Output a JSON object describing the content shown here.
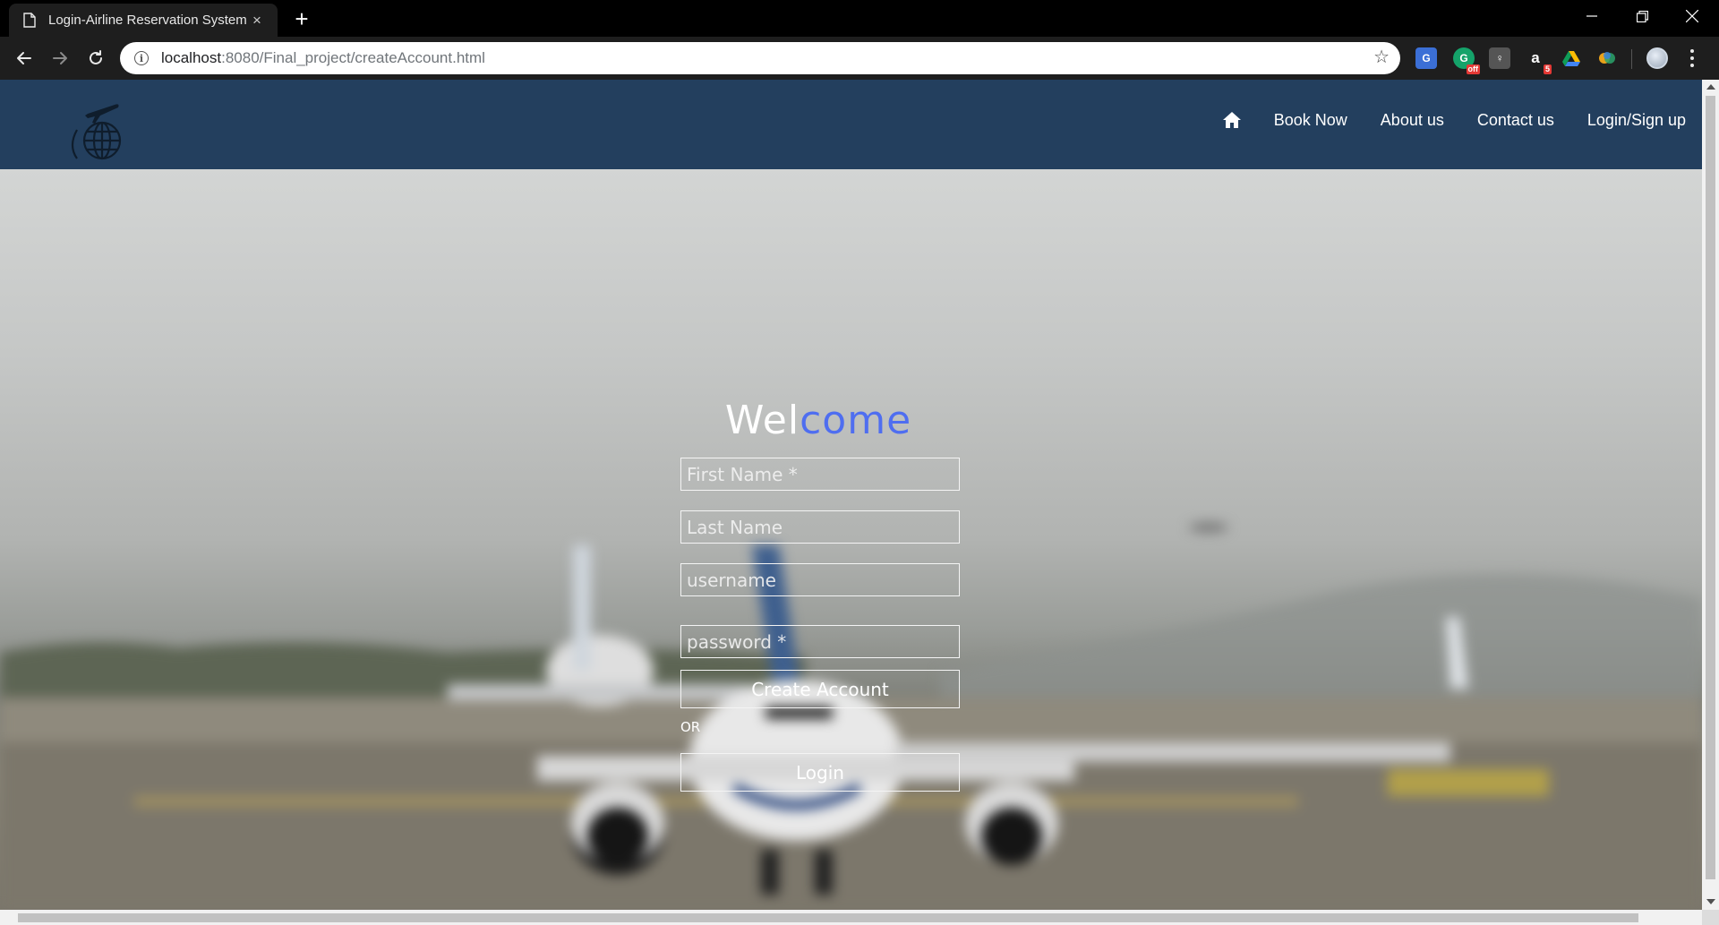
{
  "browser": {
    "tab_title": "Login-Airline Reservation System",
    "new_tab_symbol": "+",
    "tab_close_symbol": "×",
    "url_host": "localhost",
    "url_rest": ":8080/Final_project/createAccount.html",
    "info_symbol": "i",
    "bookmark_symbol": "☆",
    "extensions": [
      {
        "name": "translate-extension-icon",
        "label": "G"
      },
      {
        "name": "grammarly-extension-icon",
        "label": "G",
        "badge": "off"
      },
      {
        "name": "keep-extension-icon",
        "label": "♀"
      },
      {
        "name": "amazon-extension-icon",
        "label": "a",
        "badge": "5"
      },
      {
        "name": "drive-extension-icon",
        "label": ""
      },
      {
        "name": "colorful-extension-icon",
        "label": ""
      }
    ]
  },
  "nav": {
    "items": [
      {
        "label": "Book Now"
      },
      {
        "label": "About us"
      },
      {
        "label": "Contact us"
      },
      {
        "label": "Login/Sign up"
      }
    ]
  },
  "form": {
    "welcome_part1": "Wel",
    "welcome_part2": "come",
    "first_name_placeholder": "First Name *",
    "last_name_placeholder": "Last Name",
    "username_placeholder": "username",
    "password_placeholder": "password *",
    "create_account_label": "Create Account",
    "or_text": "OR",
    "login_label": "Login"
  },
  "colors": {
    "header_bg": "#233f5e",
    "accent": "#4f6ef0"
  }
}
